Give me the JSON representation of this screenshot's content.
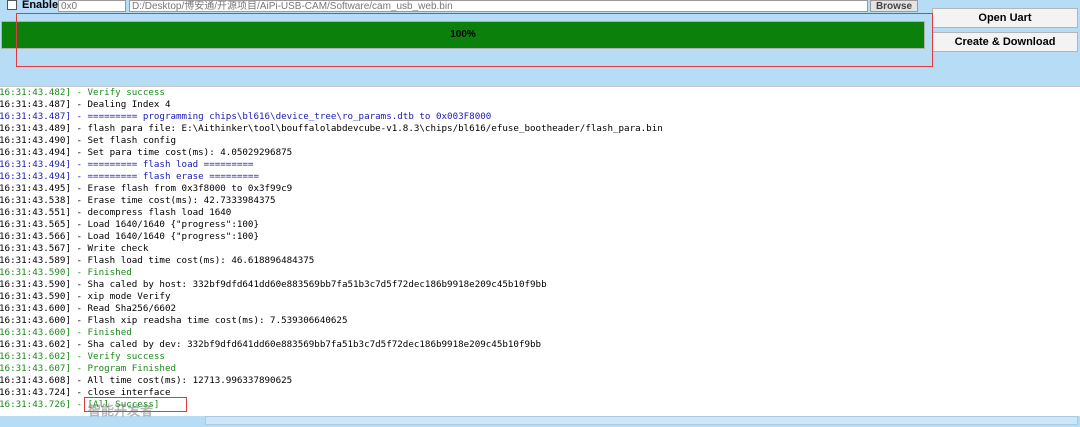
{
  "top": {
    "enable_label": "Enable",
    "address_value": "0x0",
    "path_value": "D:/Desktop/博安通/开源项目/AiPi-USB-CAM/Software/cam_usb_web.bin",
    "browse_label": "Browse"
  },
  "side": {
    "open_uart_label": "Open Uart",
    "create_download_label": "Create & Download"
  },
  "progress": {
    "value": 1.0,
    "label": "100%",
    "fill_color": "#0b800b"
  },
  "colors": {
    "success": "#1d8a1d",
    "header": "#1a1ab8",
    "highlight": "#e03a3a",
    "background": "#b7dcf6"
  },
  "log": [
    {
      "text": "16:31:43.482] - Verify success",
      "type": "success"
    },
    {
      "text": "16:31:43.487] - Dealing Index 4",
      "type": "normal"
    },
    {
      "text": "16:31:43.487] - ========= programming chips\\bl616\\device_tree\\ro_params.dtb to 0x003F8000",
      "type": "head"
    },
    {
      "text": "16:31:43.489] - flash para file: E:\\Aithinker\\tool\\bouffalolabdevcube-v1.8.3\\chips/bl616/efuse_bootheader/flash_para.bin",
      "type": "normal"
    },
    {
      "text": "16:31:43.490] - Set flash config",
      "type": "normal"
    },
    {
      "text": "16:31:43.494] - Set para time cost(ms): 4.05029296875",
      "type": "normal"
    },
    {
      "text": "16:31:43.494] - ========= flash load =========",
      "type": "head"
    },
    {
      "text": "16:31:43.494] - ========= flash erase =========",
      "type": "head"
    },
    {
      "text": "16:31:43.495] - Erase flash from 0x3f8000 to 0x3f99c9",
      "type": "normal"
    },
    {
      "text": "16:31:43.538] - Erase time cost(ms): 42.7333984375",
      "type": "normal"
    },
    {
      "text": "16:31:43.551] - decompress flash load 1640",
      "type": "normal"
    },
    {
      "text": "16:31:43.565] - Load 1640/1640 {\"progress\":100}",
      "type": "normal"
    },
    {
      "text": "16:31:43.566] - Load 1640/1640 {\"progress\":100}",
      "type": "normal"
    },
    {
      "text": "16:31:43.567] - Write check",
      "type": "normal"
    },
    {
      "text": "16:31:43.589] - Flash load time cost(ms): 46.618896484375",
      "type": "normal"
    },
    {
      "text": "16:31:43.590] - Finished",
      "type": "success"
    },
    {
      "text": "16:31:43.590] - Sha caled by host: 332bf9dfd641dd60e883569bb7fa51b3c7d5f72dec186b9918e209c45b10f9bb",
      "type": "normal"
    },
    {
      "text": "16:31:43.590] - xip mode Verify",
      "type": "normal"
    },
    {
      "text": "16:31:43.600] - Read Sha256/6602",
      "type": "normal"
    },
    {
      "text": "16:31:43.600] - Flash xip readsha time cost(ms): 7.539306640625",
      "type": "normal"
    },
    {
      "text": "16:31:43.600] - Finished",
      "type": "success"
    },
    {
      "text": "16:31:43.602] - Sha caled by dev: 332bf9dfd641dd60e883569bb7fa51b3c7d5f72dec186b9918e209c45b10f9bb",
      "type": "normal"
    },
    {
      "text": "16:31:43.602] - Verify success",
      "type": "success"
    },
    {
      "text": "16:31:43.607] - Program Finished",
      "type": "success"
    },
    {
      "text": "16:31:43.608] - All time cost(ms): 12713.996337890625",
      "type": "normal"
    },
    {
      "text": "16:31:43.724] - close interface",
      "type": "normal"
    },
    {
      "text": "16:31:43.726] - [All Success]",
      "type": "success"
    }
  ],
  "watermark": "智能开发者"
}
